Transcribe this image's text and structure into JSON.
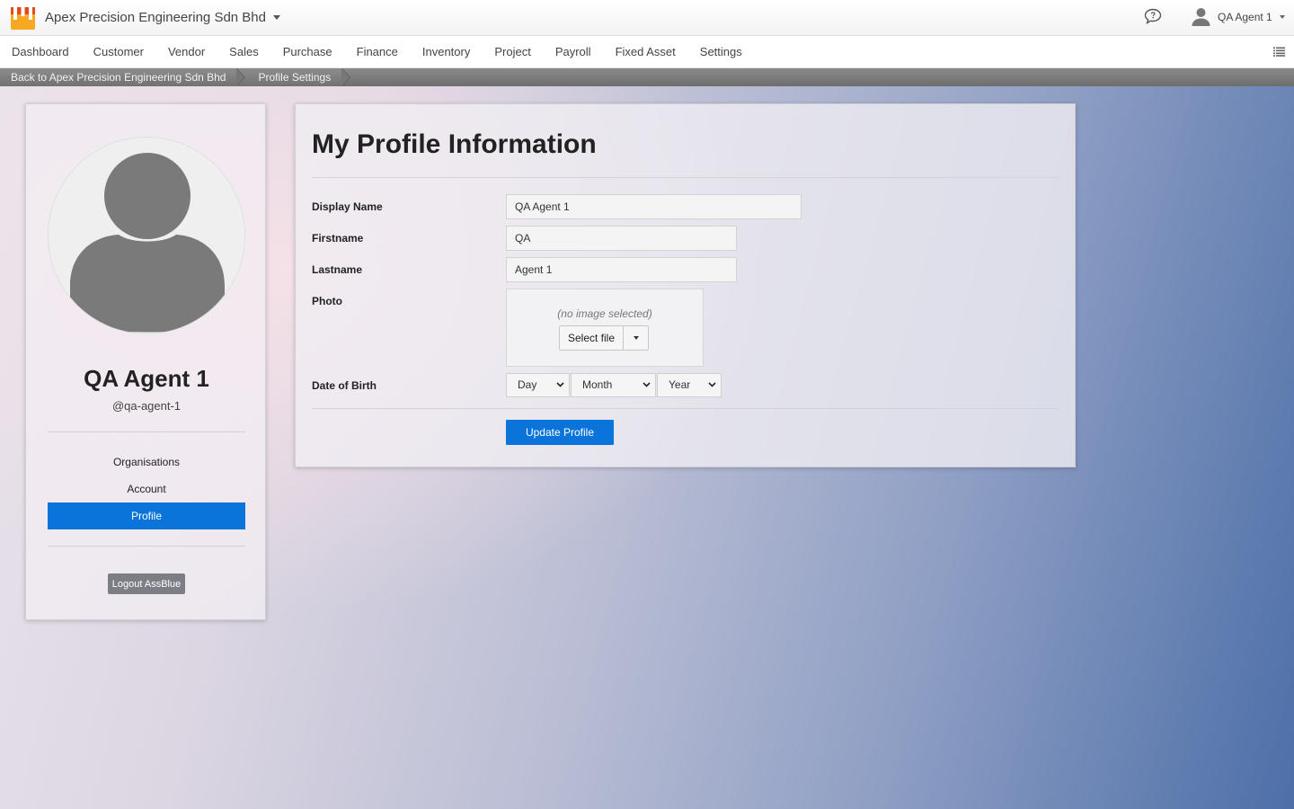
{
  "topbar": {
    "company_name": "Apex Precision Engineering Sdn Bhd",
    "user_name": "QA Agent 1"
  },
  "nav": {
    "items": [
      "Dashboard",
      "Customer",
      "Vendor",
      "Sales",
      "Purchase",
      "Finance",
      "Inventory",
      "Project",
      "Payroll",
      "Fixed Asset",
      "Settings"
    ]
  },
  "breadcrumb": {
    "back": "Back to Apex Precision Engineering Sdn Bhd",
    "current": "Profile Settings"
  },
  "sidebar": {
    "display_name": "QA Agent 1",
    "handle": "@qa-agent-1",
    "links": [
      "Organisations",
      "Account",
      "Profile"
    ],
    "active_link": "Profile",
    "logout_label": "Logout AssBlue"
  },
  "form": {
    "title": "My Profile Information",
    "display_name_label": "Display Name",
    "display_name_value": "QA Agent 1",
    "firstname_label": "Firstname",
    "firstname_value": "QA",
    "lastname_label": "Lastname",
    "lastname_value": "Agent 1",
    "photo_label": "Photo",
    "photo_empty_text": "(no image selected)",
    "select_file_label": "Select file",
    "dob_label": "Date of Birth",
    "dob_day": "Day",
    "dob_month": "Month",
    "dob_year": "Year",
    "submit_label": "Update Profile"
  },
  "colors": {
    "primary": "#0a74da",
    "logout": "#7b7f85",
    "logo_orange": "#f7a823",
    "logo_red": "#e64a19"
  }
}
